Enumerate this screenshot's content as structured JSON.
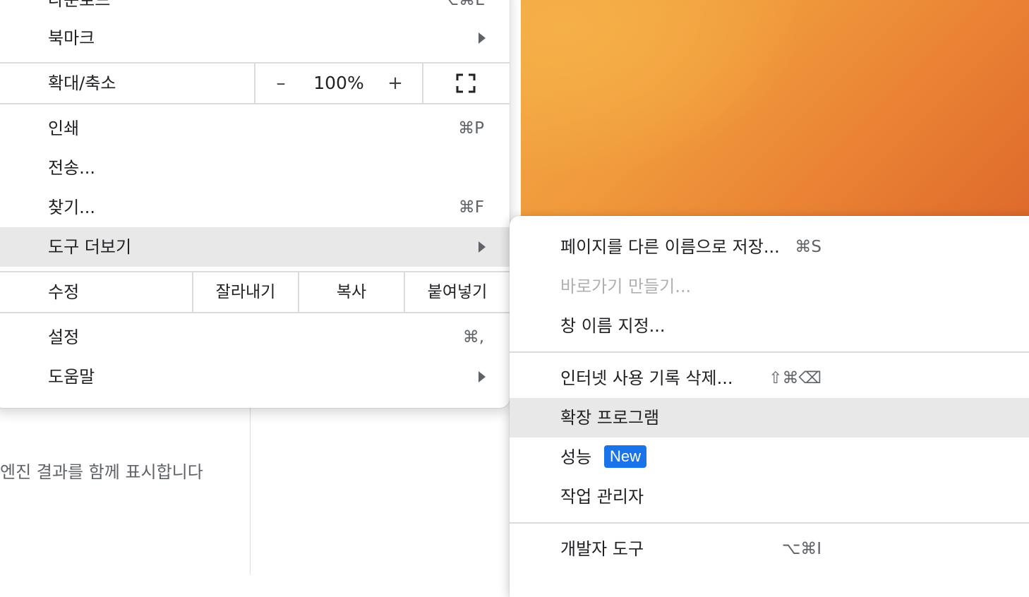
{
  "background": {
    "search_hint": "엔진 결과를 함께 표시합니다"
  },
  "menu": {
    "top_partial_label": "다운로드",
    "top_partial_shortcut": "⌥⌘L",
    "bookmarks": "북마크",
    "zoom": {
      "label": "확대/축소",
      "minus": "–",
      "value": "100%",
      "plus": "+"
    },
    "print": {
      "label": "인쇄",
      "shortcut": "⌘P"
    },
    "cast": {
      "label": "전송..."
    },
    "find": {
      "label": "찾기...",
      "shortcut": "⌘F"
    },
    "more_tools": {
      "label": "도구 더보기"
    },
    "edit": {
      "label": "수정",
      "cut": "잘라내기",
      "copy": "복사",
      "paste": "붙여넣기"
    },
    "settings": {
      "label": "설정",
      "shortcut": "⌘,"
    },
    "help": {
      "label": "도움말"
    }
  },
  "submenu": {
    "save_page": {
      "label": "페이지를 다른 이름으로 저장...",
      "shortcut": "⌘S"
    },
    "create_shortcut": {
      "label": "바로가기 만들기..."
    },
    "name_window": {
      "label": "창 이름 지정..."
    },
    "clear_history": {
      "label": "인터넷 사용 기록 삭제...",
      "shortcut": "⇧⌘⌫"
    },
    "extensions": {
      "label": "확장 프로그램"
    },
    "performance": {
      "label": "성능",
      "badge": "New"
    },
    "task_manager": {
      "label": "작업 관리자"
    },
    "devtools": {
      "label": "개발자 도구",
      "shortcut": "⌥⌘I"
    }
  },
  "colors": {
    "highlight": "#e8e8e8",
    "badge": "#1a73e8",
    "disabled_text": "#b0b0b0"
  }
}
